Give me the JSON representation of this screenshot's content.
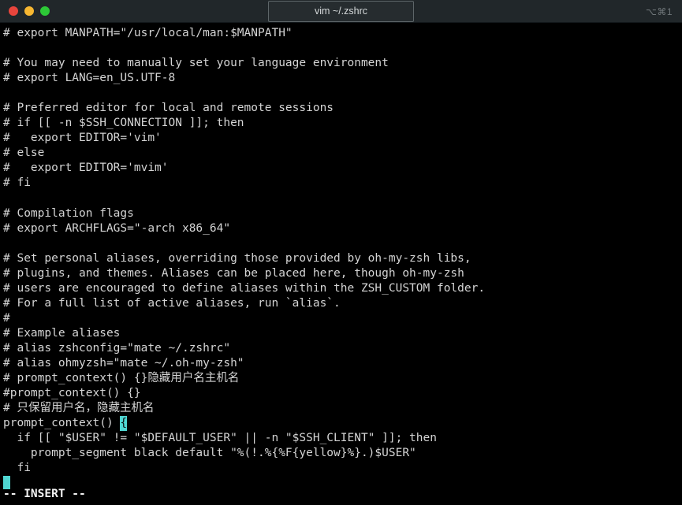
{
  "window": {
    "title": "vim ~/.zshrc",
    "shortcut_hint": "⌥⌘1",
    "traffic_lights": {
      "close_label": "close-window",
      "minimize_label": "minimize-window",
      "zoom_label": "zoom-window"
    },
    "colors": {
      "titlebar_bg": "#21272a",
      "terminal_bg": "#000000",
      "text": "#d4d4d4",
      "cursor": "#4fd6d2",
      "close": "#e8453c",
      "minimize": "#f7b731",
      "zoom": "#2dc937"
    }
  },
  "editor": {
    "mode_status": "-- INSERT --",
    "cursor": {
      "char": "{",
      "line_index": 26,
      "column": 17
    },
    "lines": [
      "# export MANPATH=\"/usr/local/man:$MANPATH\"",
      "",
      "# You may need to manually set your language environment",
      "# export LANG=en_US.UTF-8",
      "",
      "# Preferred editor for local and remote sessions",
      "# if [[ -n $SSH_CONNECTION ]]; then",
      "#   export EDITOR='vim'",
      "# else",
      "#   export EDITOR='mvim'",
      "# fi",
      "",
      "# Compilation flags",
      "# export ARCHFLAGS=\"-arch x86_64\"",
      "",
      "# Set personal aliases, overriding those provided by oh-my-zsh libs,",
      "# plugins, and themes. Aliases can be placed here, though oh-my-zsh",
      "# users are encouraged to define aliases within the ZSH_CUSTOM folder.",
      "# For a full list of active aliases, run `alias`.",
      "#",
      "# Example aliases",
      "# alias zshconfig=\"mate ~/.zshrc\"",
      "# alias ohmyzsh=\"mate ~/.oh-my-zsh\"",
      "# prompt_context() {}隐藏用户名主机名",
      "#prompt_context() {}",
      "# 只保留用户名，隐藏主机名"
    ],
    "cursor_line_prefix": "prompt_context() ",
    "tail_lines": [
      "  if [[ \"$USER\" != \"$DEFAULT_USER\" || -n \"$SSH_CLIENT\" ]]; then",
      "    prompt_segment black default \"%(!.%{%F{yellow}%}.)$USER\"",
      "  fi"
    ]
  }
}
